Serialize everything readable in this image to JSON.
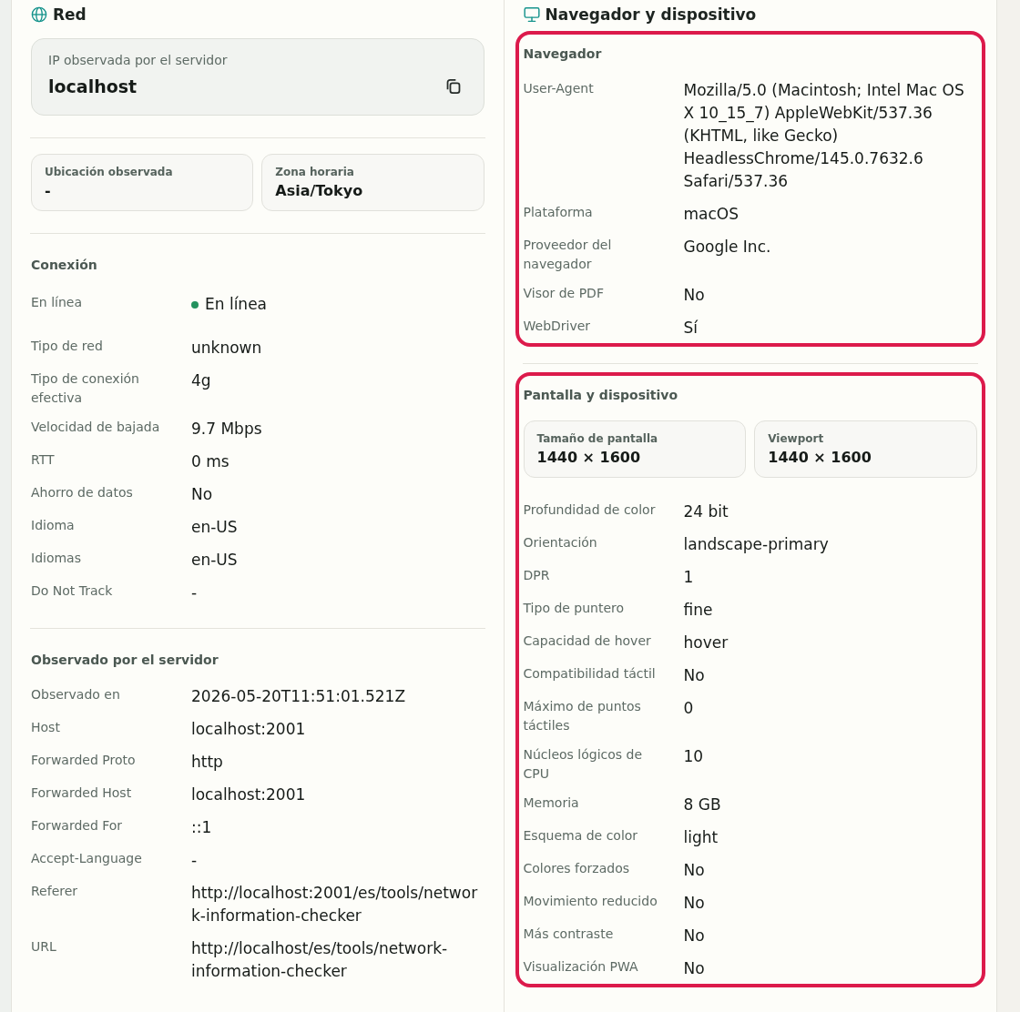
{
  "panels": [
    {
      "title": "Red",
      "blocks": [
        {
          "kind": "hero",
          "label": "IP observada por el servidor",
          "value": "localhost"
        },
        {
          "kind": "tiles",
          "tiles": [
            {
              "label": "Ubicación observada",
              "value": "-"
            },
            {
              "label": "Zona horaria",
              "value": "Asia/Tokyo"
            }
          ]
        },
        {
          "kind": "section",
          "title": "Conexión",
          "highlighted": false,
          "rows": [
            {
              "kind": "status",
              "label": "En línea",
              "value": "En línea",
              "color": "#23925f"
            },
            {
              "kind": "text",
              "label": "Tipo de red",
              "value": "unknown"
            },
            {
              "kind": "text",
              "label": "Tipo de conexión efectiva",
              "value": "4g"
            },
            {
              "kind": "text",
              "label": "Velocidad de bajada",
              "value": "9.7 Mbps"
            },
            {
              "kind": "text",
              "label": "RTT",
              "value": "0 ms"
            },
            {
              "kind": "text",
              "label": "Ahorro de datos",
              "value": "No"
            },
            {
              "kind": "text",
              "label": "Idioma",
              "value": "en-US"
            },
            {
              "kind": "text",
              "label": "Idiomas",
              "value": "en-US"
            },
            {
              "kind": "text",
              "label": "Do Not Track",
              "value": "-"
            }
          ]
        },
        {
          "kind": "section",
          "title": "Observado por el servidor",
          "highlighted": false,
          "rows": [
            {
              "label": "Observado en",
              "value": "2026-05-20T11:51:01.521Z"
            },
            {
              "label": "Host",
              "value": "localhost:2001"
            },
            {
              "label": "Forwarded Proto",
              "value": "http"
            },
            {
              "label": "Forwarded Host",
              "value": "localhost:2001"
            },
            {
              "label": "Forwarded For",
              "value": "::1"
            },
            {
              "label": "Accept-Language",
              "value": "-"
            },
            {
              "label": "Referer",
              "value": "http://localhost:2001/es/tools/network-information-checker"
            },
            {
              "label": "URL",
              "value": "http://localhost/es/tools/network-information-checker"
            }
          ]
        }
      ]
    },
    {
      "title": "Navegador y dispositivo",
      "blocks": [
        {
          "kind": "section",
          "title": "Navegador",
          "highlighted": true,
          "rows": [
            {
              "label": "User-Agent",
              "value": "Mozilla/5.0 (Macintosh; Intel Mac OS X 10_15_7) AppleWebKit/537.36 (KHTML, like Gecko) HeadlessChrome/145.0.7632.6 Safari/537.36"
            },
            {
              "label": "Plataforma",
              "value": "macOS"
            },
            {
              "label": "Proveedor del navegador",
              "value": "Google Inc."
            },
            {
              "label": "Visor de PDF",
              "value": "No"
            },
            {
              "label": "WebDriver",
              "value": "Sí"
            }
          ]
        },
        {
          "kind": "section",
          "title": "Pantalla y dispositivo",
          "highlighted": true,
          "tiles": [
            {
              "label": "Tamaño de pantalla",
              "value": "1440 × 1600"
            },
            {
              "label": "Viewport",
              "value": "1440 × 1600"
            }
          ],
          "rows": [
            {
              "label": "Profundidad de color",
              "value": "24 bit"
            },
            {
              "label": "Orientación",
              "value": "landscape-primary"
            },
            {
              "label": "DPR",
              "value": "1"
            },
            {
              "label": "Tipo de puntero",
              "value": "fine"
            },
            {
              "label": "Capacidad de hover",
              "value": "hover"
            },
            {
              "label": "Compatibilidad táctil",
              "value": "No"
            },
            {
              "label": "Máximo de puntos táctiles",
              "value": "0"
            },
            {
              "label": "Núcleos lógicos de CPU",
              "value": "10"
            },
            {
              "label": "Memoria",
              "value": "8 GB"
            },
            {
              "label": "Esquema de color",
              "value": "light"
            },
            {
              "label": "Colores forzados",
              "value": "No"
            },
            {
              "label": "Movimiento reducido",
              "value": "No"
            },
            {
              "label": "Más contraste",
              "value": "No"
            },
            {
              "label": "Visualización PWA",
              "value": "No"
            }
          ]
        }
      ]
    }
  ]
}
